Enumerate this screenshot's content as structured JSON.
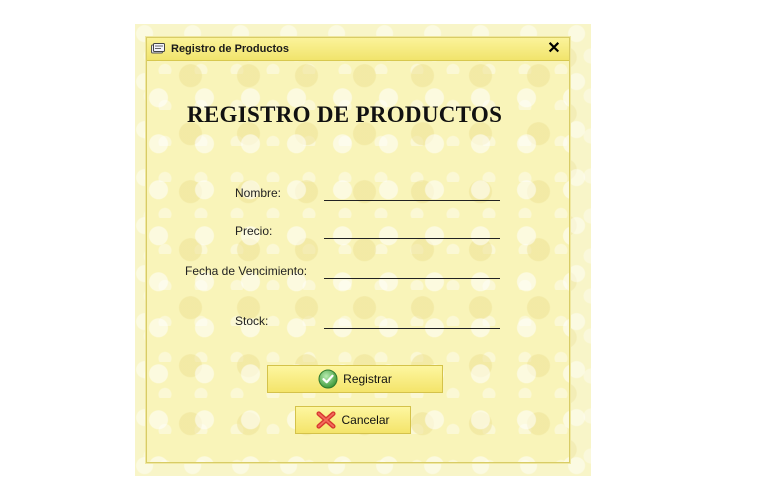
{
  "window": {
    "title": "Registro de Productos",
    "close_symbol": "✕"
  },
  "form": {
    "heading": "REGISTRO DE PRODUCTOS",
    "fields": [
      {
        "label": "Nombre:",
        "value": ""
      },
      {
        "label": "Precio:",
        "value": ""
      },
      {
        "label": "Fecha de Vencimiento:",
        "value": ""
      },
      {
        "label": "Stock:",
        "value": ""
      }
    ]
  },
  "buttons": {
    "register": {
      "label": "Registrar",
      "icon": "check-circle-icon"
    },
    "cancel": {
      "label": "Cancelar",
      "icon": "red-x-icon"
    }
  },
  "colors": {
    "background": "#f9f4b9",
    "titlebar": "#f1e46c",
    "button": "#f4e46a"
  }
}
